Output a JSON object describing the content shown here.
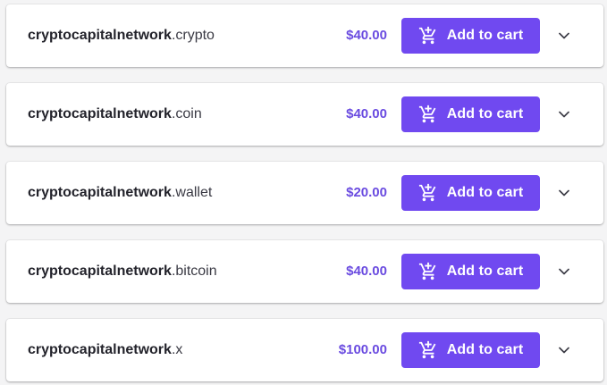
{
  "domains": [
    {
      "name": "cryptocapitalnetwork",
      "tld": ".crypto",
      "price": "$40.00",
      "button_label": "Add to cart"
    },
    {
      "name": "cryptocapitalnetwork",
      "tld": ".coin",
      "price": "$40.00",
      "button_label": "Add to cart"
    },
    {
      "name": "cryptocapitalnetwork",
      "tld": ".wallet",
      "price": "$20.00",
      "button_label": "Add to cart"
    },
    {
      "name": "cryptocapitalnetwork",
      "tld": ".bitcoin",
      "price": "$40.00",
      "button_label": "Add to cart"
    },
    {
      "name": "cryptocapitalnetwork",
      "tld": ".x",
      "price": "$100.00",
      "button_label": "Add to cart"
    }
  ],
  "icons": {
    "button": "add-shopping-cart-icon",
    "expand": "chevron-down-icon"
  },
  "colors": {
    "accent": "#7049f0",
    "price": "#6a4be0",
    "text": "#2b2b33",
    "card": "#ffffff",
    "background": "#f4f4f5"
  }
}
